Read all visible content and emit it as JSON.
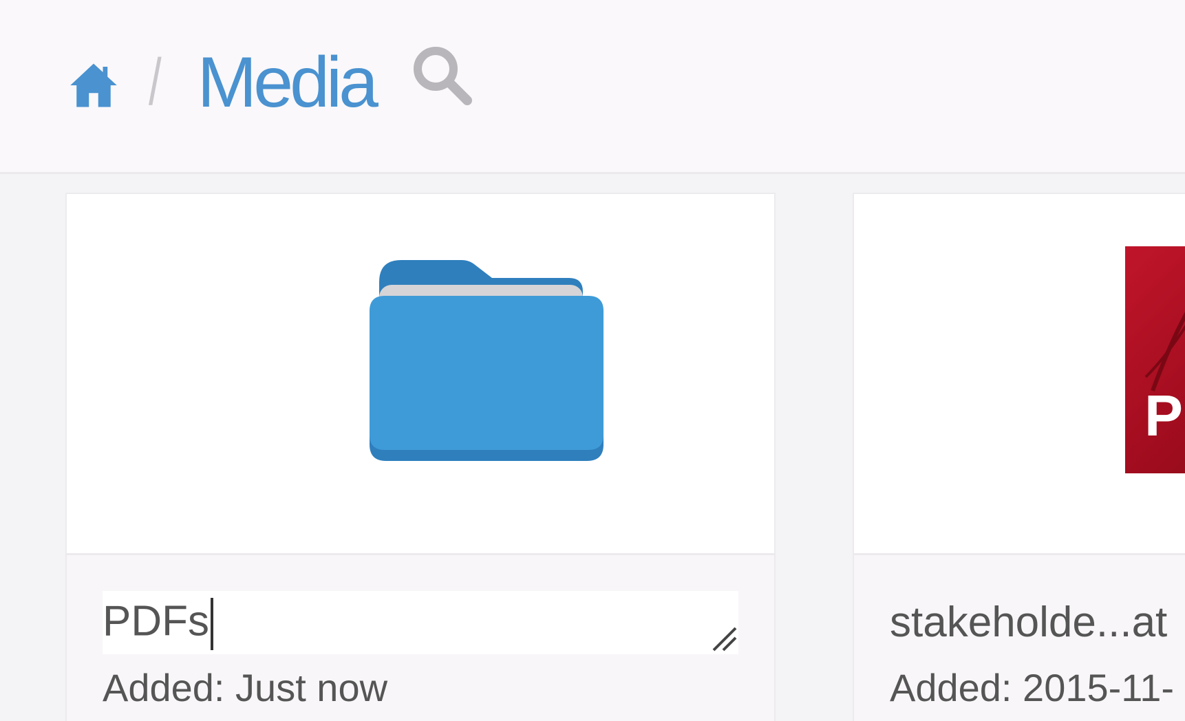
{
  "breadcrumb": {
    "home_icon": "home-icon",
    "separator": "/",
    "title": "Media",
    "search_icon": "search-icon"
  },
  "colors": {
    "accent": "#4a92d0",
    "folder": "#3f9bd8",
    "pdf": "#c0152a",
    "text": "#555555"
  },
  "items": [
    {
      "type": "folder",
      "icon": "folder-icon",
      "name_value": "PDFs",
      "added": "Added: Just now"
    },
    {
      "type": "pdf",
      "icon": "pdf-file-icon",
      "pdf_label": "P",
      "name": "stakeholde...at",
      "added": "Added: 2015-11-"
    }
  ]
}
